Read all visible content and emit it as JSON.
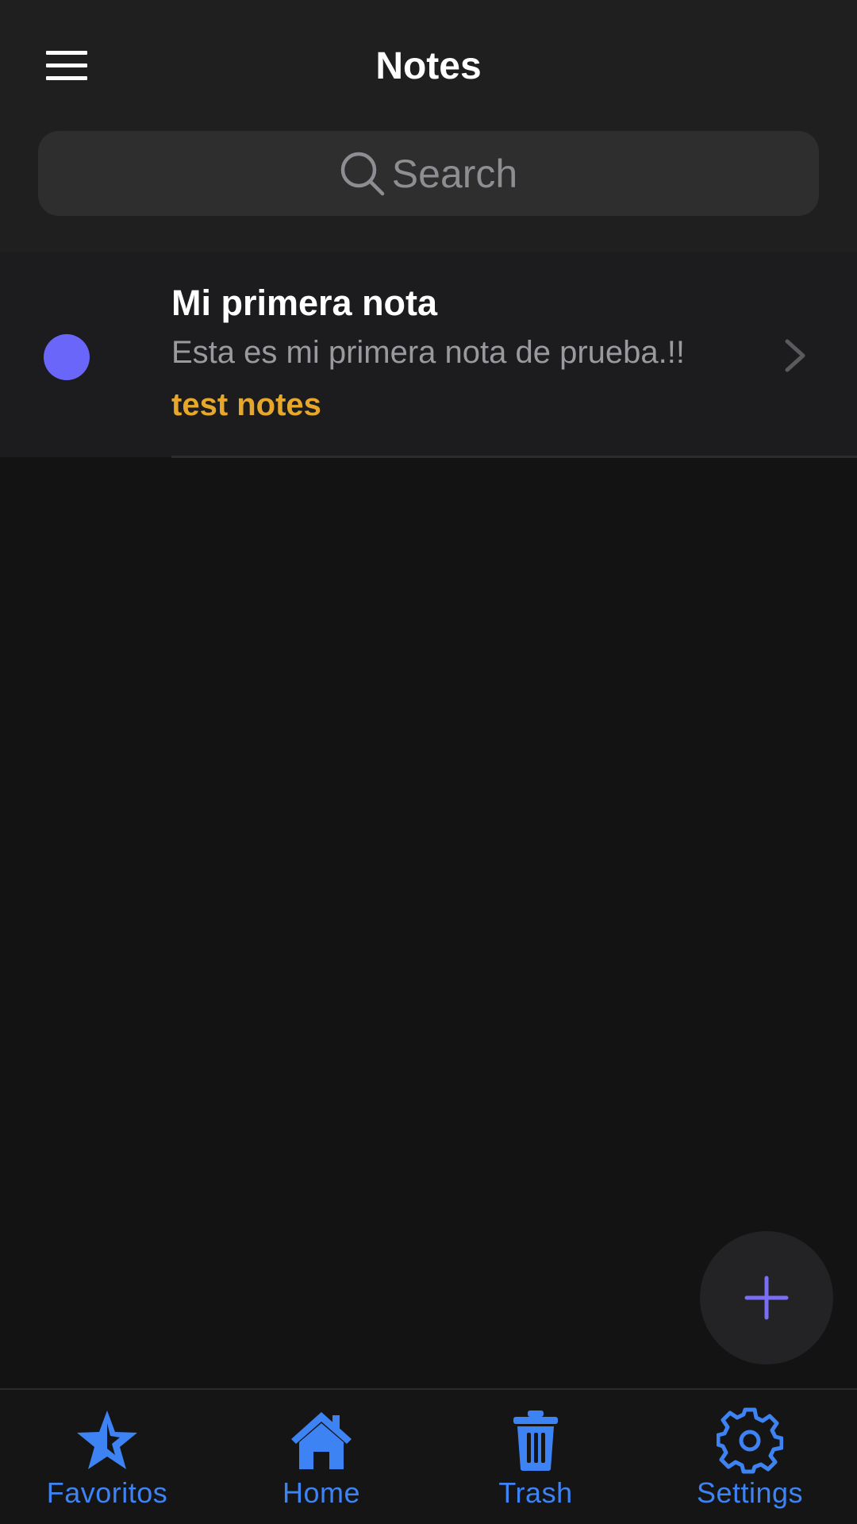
{
  "header": {
    "title": "Notes",
    "menu_icon": "hamburger-menu-icon"
  },
  "search": {
    "placeholder": "Search",
    "icon": "search-icon"
  },
  "notes": [
    {
      "title": "Mi primera nota",
      "body": "Esta es mi primera nota de prueba.!!",
      "tag": "test notes",
      "dot_color": "#6b66fa"
    }
  ],
  "fab": {
    "icon": "plus-icon",
    "color": "#7b6ef6"
  },
  "tabbar": {
    "accent": "#3d83f4",
    "tabs": [
      {
        "label": "Favoritos",
        "icon": "star-icon"
      },
      {
        "label": "Home",
        "icon": "home-icon"
      },
      {
        "label": "Trash",
        "icon": "trash-icon"
      },
      {
        "label": "Settings",
        "icon": "gear-icon"
      }
    ]
  },
  "colors": {
    "background": "#131314",
    "header_bg": "#1f1f20",
    "search_bg": "#2e2e2f",
    "row_bg": "#1c1c1e",
    "tag": "#e6a72a"
  }
}
